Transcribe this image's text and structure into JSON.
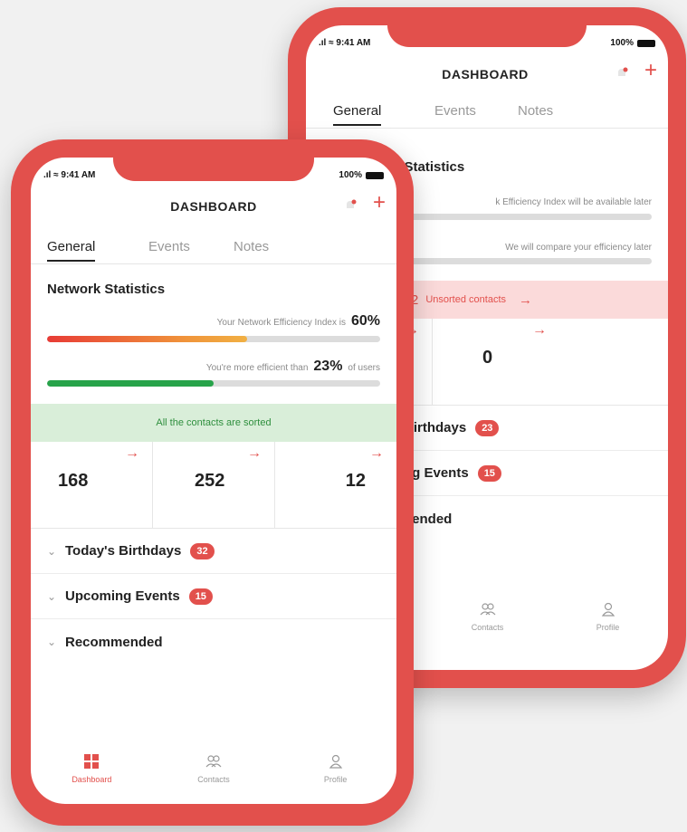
{
  "status_bar": {
    "time": "9:41 AM",
    "battery": "100%"
  },
  "header": {
    "title": "DASHBOARD",
    "add_label": "+"
  },
  "tabs": [
    {
      "label": "General",
      "active": true
    },
    {
      "label": "Events",
      "active": false
    },
    {
      "label": "Notes",
      "active": false
    }
  ],
  "front": {
    "section_title": "Network Statistics",
    "efficiency_text": "Your Network Efficiency Index is",
    "efficiency_pct": "60%",
    "efficiency_value": 0.6,
    "compare_text": "You're more efficient than",
    "compare_pct": "23%",
    "compare_suffix": "of users",
    "compare_value": 0.5,
    "banner": "All the contacts are sorted",
    "counters": [
      "168",
      "252",
      "12"
    ],
    "birthdays_label": "Today's Birthdays",
    "birthdays_count": "32",
    "events_label": "Upcoming Events",
    "events_count": "15",
    "recommended_label": "Recommended"
  },
  "back": {
    "section_title": "k Statistics",
    "efficiency_text": "k Efficiency Index will be available later",
    "efficiency_value": 0.22,
    "compare_text": "We will compare your efficiency later",
    "compare_value": 0.22,
    "banner_count": "2",
    "banner_text": "Unsorted contacts",
    "counters": [
      "0",
      "0"
    ],
    "birthdays_label": "Birthdays",
    "birthdays_count": "23",
    "events_label": "ng Events",
    "events_count": "15",
    "recommended_label": "nended"
  },
  "bottom_nav": [
    {
      "label": "Dashboard",
      "icon": "grid-icon"
    },
    {
      "label": "Contacts",
      "icon": "contacts-icon"
    },
    {
      "label": "Profile",
      "icon": "profile-icon"
    }
  ],
  "colors": {
    "accent": "#e2504c",
    "green": "#27a34a",
    "banner_green": "#d9eed9",
    "banner_pink": "#fbdada"
  }
}
